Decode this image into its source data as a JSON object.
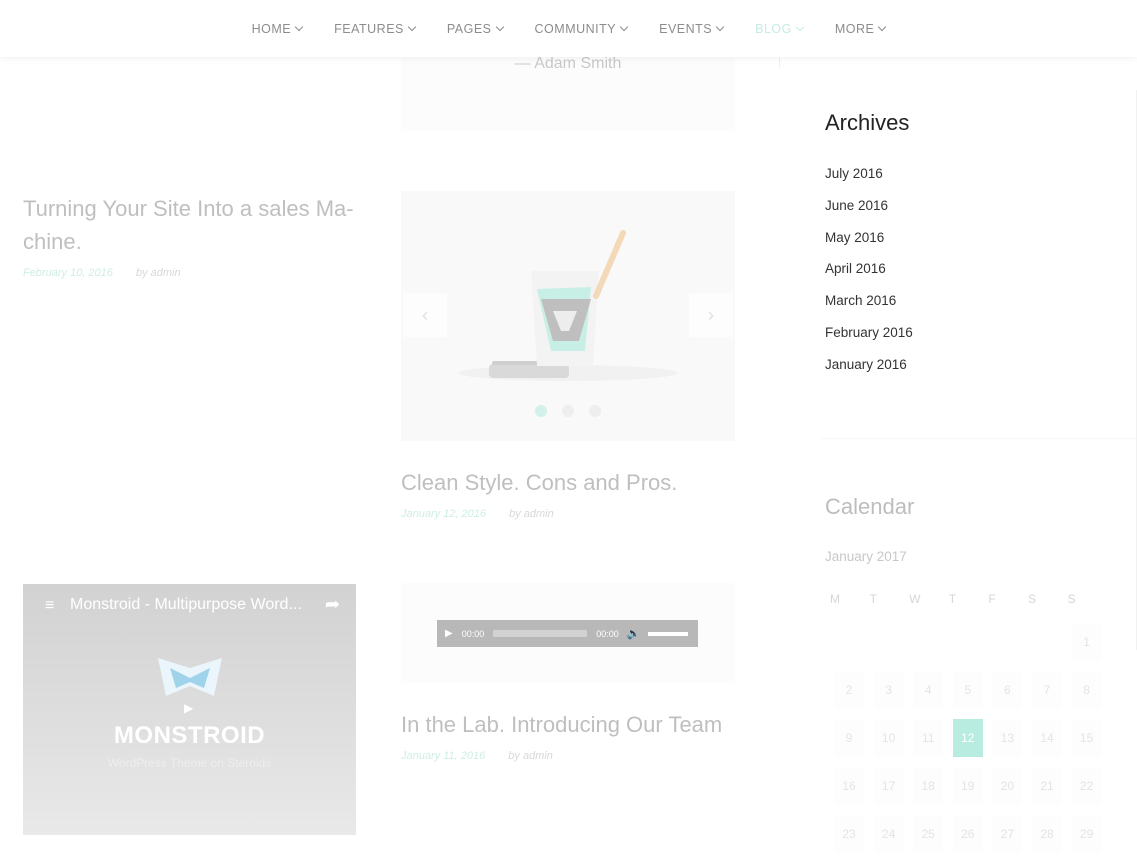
{
  "nav": {
    "items": [
      {
        "label": "HOME"
      },
      {
        "label": "FEATURES"
      },
      {
        "label": "PAGES"
      },
      {
        "label": "COMMUNITY"
      },
      {
        "label": "EVENTS"
      },
      {
        "label": "BLOG",
        "active": true
      },
      {
        "label": "MORE"
      }
    ],
    "active_color": "#c4ece3"
  },
  "quote": {
    "author": "— Adam Smith"
  },
  "posts": [
    {
      "title": "Turning Your Site Into a sales Ma-chine.",
      "date": "February 10, 2016",
      "author": "by admin"
    },
    {
      "title": "Clean Style. Cons and Pros.",
      "date": "January 12, 2016",
      "author": "by admin"
    },
    {
      "title": "In the Lab. Introducing Our Team",
      "date": "January 11, 2016",
      "author": "by admin"
    }
  ],
  "slider": {
    "slides": 3,
    "active": 0,
    "prev_icon": "chevron-left-icon",
    "next_icon": "chevron-right-icon"
  },
  "audio": {
    "current": "00:00",
    "duration": "00:00"
  },
  "video": {
    "title": "Monstroid - Multipurpose Word...",
    "brand": "MONSTROID",
    "tagline": "WordPress Theme on Steroids"
  },
  "archives": {
    "title": "Archives",
    "items": [
      "July 2016",
      "June 2016",
      "May 2016",
      "April 2016",
      "March 2016",
      "February 2016",
      "January 2016"
    ]
  },
  "calendar": {
    "title": "Calendar",
    "month": "January 2017",
    "weekdays": [
      "M",
      "T",
      "W",
      "T",
      "F",
      "S",
      "S"
    ],
    "today": 12,
    "weeks": [
      [
        "",
        "",
        "",
        "",
        "",
        "",
        "1"
      ],
      [
        "2",
        "3",
        "4",
        "5",
        "6",
        "7",
        "8"
      ],
      [
        "9",
        "10",
        "11",
        "12",
        "13",
        "14",
        "15"
      ],
      [
        "16",
        "17",
        "18",
        "19",
        "20",
        "21",
        "22"
      ],
      [
        "23",
        "24",
        "25",
        "26",
        "27",
        "28",
        "29"
      ]
    ],
    "accent": "#b8ece0"
  }
}
